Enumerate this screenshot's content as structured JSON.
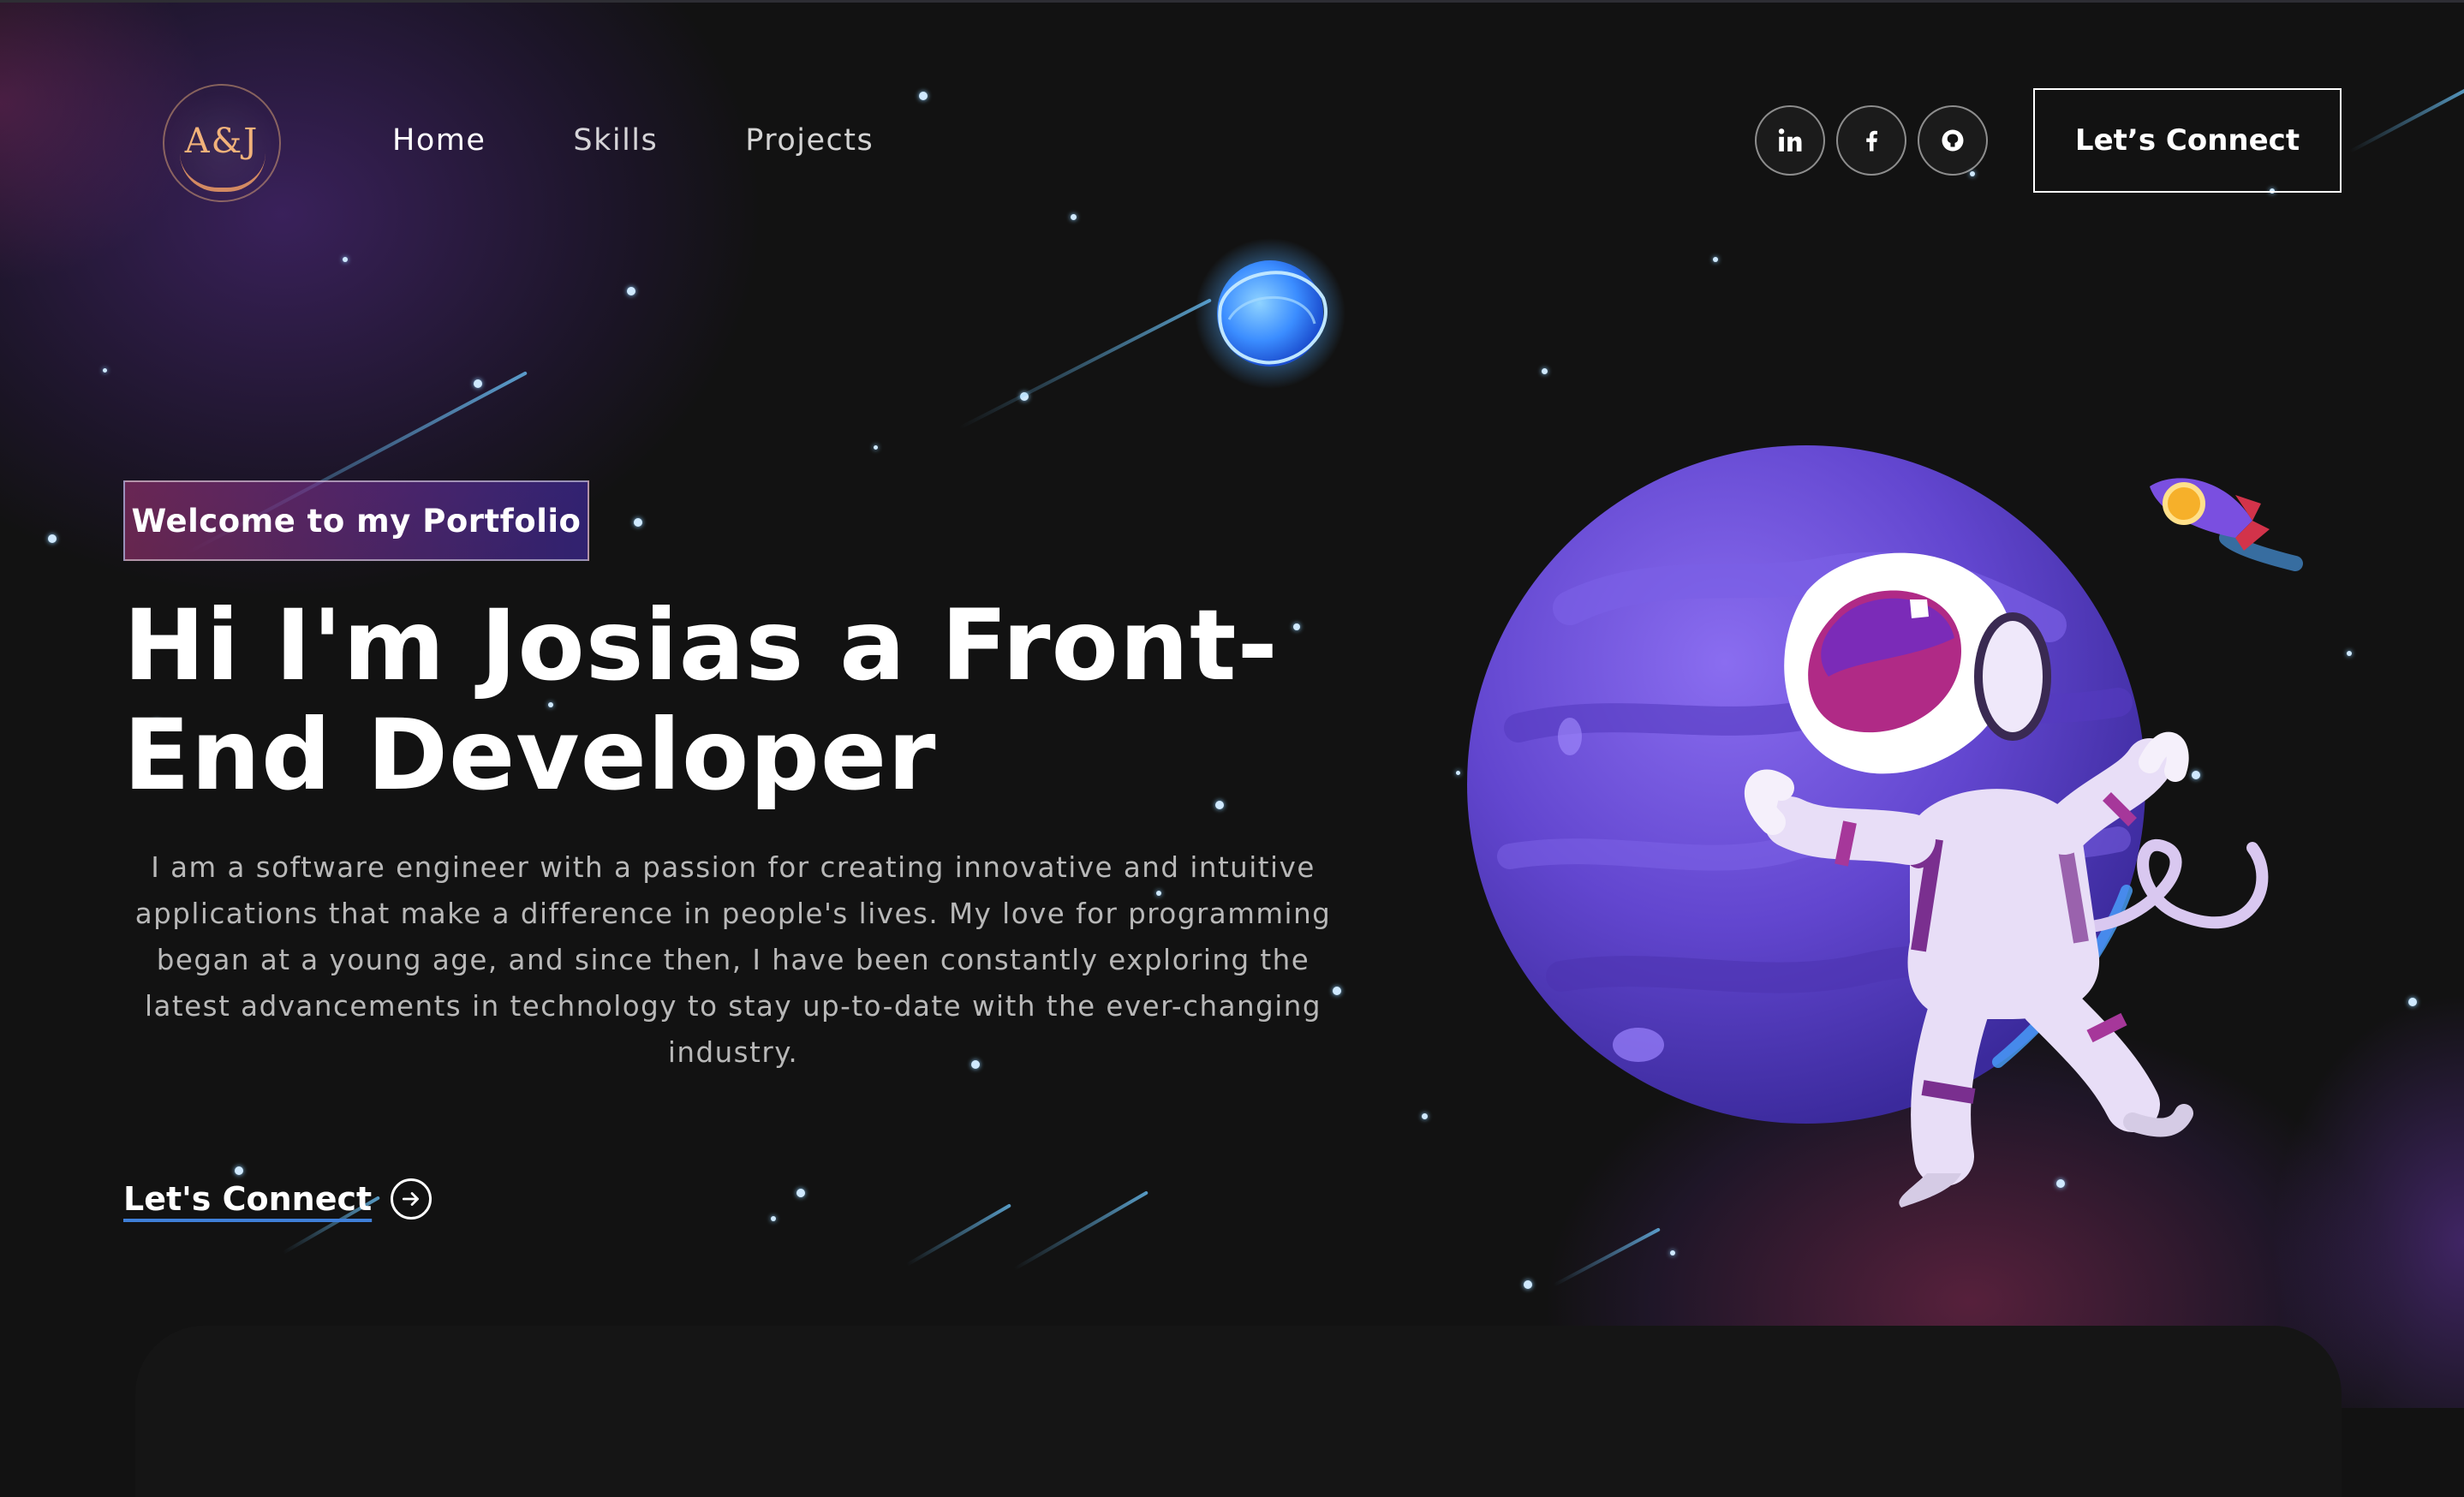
{
  "nav": {
    "logo_text": "A&J",
    "links": [
      "Home",
      "Skills",
      "Projects"
    ],
    "social_icons": [
      "linkedin-icon",
      "facebook-icon",
      "github-icon"
    ],
    "connect_label": "Let’s Connect"
  },
  "hero": {
    "tagline": "Welcome to my Portfolio",
    "title": "Hi I'm Josias a Front-End Developer",
    "description": "I am a software engineer with a passion for creating innovative and intuitive applications that make a difference in people's lives. My love for programming began at a young age, and since then, I have been constantly exploring the latest advancements in technology to stay up-to-date with the ever-changing industry.",
    "cta_label": "Let's Connect",
    "cta_icon": "arrow-right-circle-icon"
  },
  "colors": {
    "background": "#121212",
    "tagline_gradient_start": "#aa367c",
    "tagline_gradient_end": "#4a2fbd",
    "planet": "#6d4fd4",
    "small_planet": "#4fb0ff",
    "logo_gold": "#f2b27a",
    "link_underline": "#3f7fd8"
  }
}
